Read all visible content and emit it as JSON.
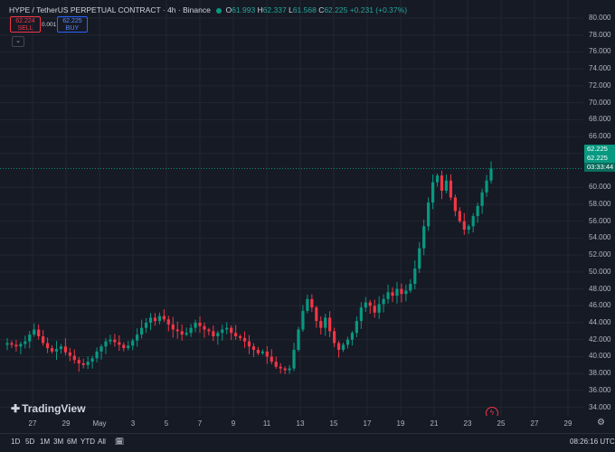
{
  "legend": {
    "symbol": "HYPE / TetherUS PERPETUAL CONTRACT · 4h · Binance",
    "o_label": "O",
    "o_val": "61.993",
    "h_label": "H",
    "h_val": "62.337",
    "l_label": "L",
    "l_val": "61.568",
    "c_label": "C",
    "c_val": "62.225",
    "change": "+0.231 (+0.37%)"
  },
  "trade": {
    "sell_price": "62.224",
    "sell_label": "SELL",
    "spread": "0.001",
    "buy_price": "62.225",
    "buy_label": "BUY"
  },
  "price_axis_ticks": [
    "80.000",
    "78.000",
    "76.000",
    "74.000",
    "72.000",
    "70.000",
    "68.000",
    "66.000",
    "64.000",
    "60.000",
    "58.000",
    "56.000",
    "54.000",
    "52.000",
    "50.000",
    "48.000",
    "46.000",
    "44.000",
    "42.000",
    "40.000",
    "38.000",
    "36.000",
    "34.000"
  ],
  "current_price": {
    "tag1": "62.225",
    "tag2": "62.225",
    "countdown": "03:33:44"
  },
  "time_axis_ticks": [
    "27",
    "29",
    "May",
    "3",
    "5",
    "7",
    "9",
    "11",
    "13",
    "15",
    "17",
    "19",
    "21",
    "23",
    "25",
    "27",
    "29"
  ],
  "bottom_bar": {
    "ranges": [
      "1D",
      "5D",
      "1M",
      "3M",
      "6M",
      "YTD",
      "All"
    ],
    "clock": "08:26:16 UTC"
  },
  "brand": "TradingView",
  "colors": {
    "up": "#089981",
    "down": "#f23645",
    "bg": "#161a25"
  },
  "chart_data": {
    "type": "candlestick",
    "title": "",
    "ylim": [
      33,
      80
    ],
    "x_ticks": [
      "27",
      "29",
      "May",
      "3",
      "5",
      "7",
      "9",
      "11",
      "13",
      "15",
      "17",
      "19",
      "21",
      "23",
      "25",
      "27",
      "29"
    ],
    "path_close": [
      41.6,
      41.4,
      41.2,
      41.5,
      41.8,
      42.6,
      43.2,
      42.4,
      41.6,
      41.0,
      40.6,
      40.9,
      41.2,
      40.5,
      40.1,
      39.6,
      39.2,
      39.0,
      39.4,
      39.8,
      40.6,
      41.2,
      41.8,
      42.0,
      41.7,
      41.4,
      41.0,
      41.3,
      41.9,
      42.6,
      43.4,
      44.0,
      44.6,
      44.2,
      44.8,
      44.4,
      43.8,
      43.2,
      43.0,
      42.6,
      42.8,
      43.4,
      44.0,
      43.6,
      43.2,
      43.0,
      42.4,
      42.8,
      43.2,
      43.4,
      42.8,
      42.4,
      42.2,
      41.8,
      41.2,
      40.8,
      40.4,
      40.6,
      40.0,
      39.4,
      38.8,
      38.6,
      38.4,
      38.6,
      40.8,
      43.2,
      45.4,
      46.8,
      45.8,
      44.2,
      43.4,
      44.6,
      43.0,
      41.6,
      40.8,
      41.4,
      42.0,
      42.8,
      44.2,
      45.8,
      46.4,
      46.0,
      45.2,
      46.2,
      46.8,
      47.6,
      47.2,
      48.0,
      47.4,
      47.8,
      48.6,
      50.4,
      52.8,
      55.4,
      58.2,
      60.6,
      61.4,
      59.6,
      60.8,
      58.8,
      57.2,
      56.0,
      55.0,
      55.4,
      56.6,
      57.8,
      59.4,
      60.8,
      62.225
    ]
  }
}
